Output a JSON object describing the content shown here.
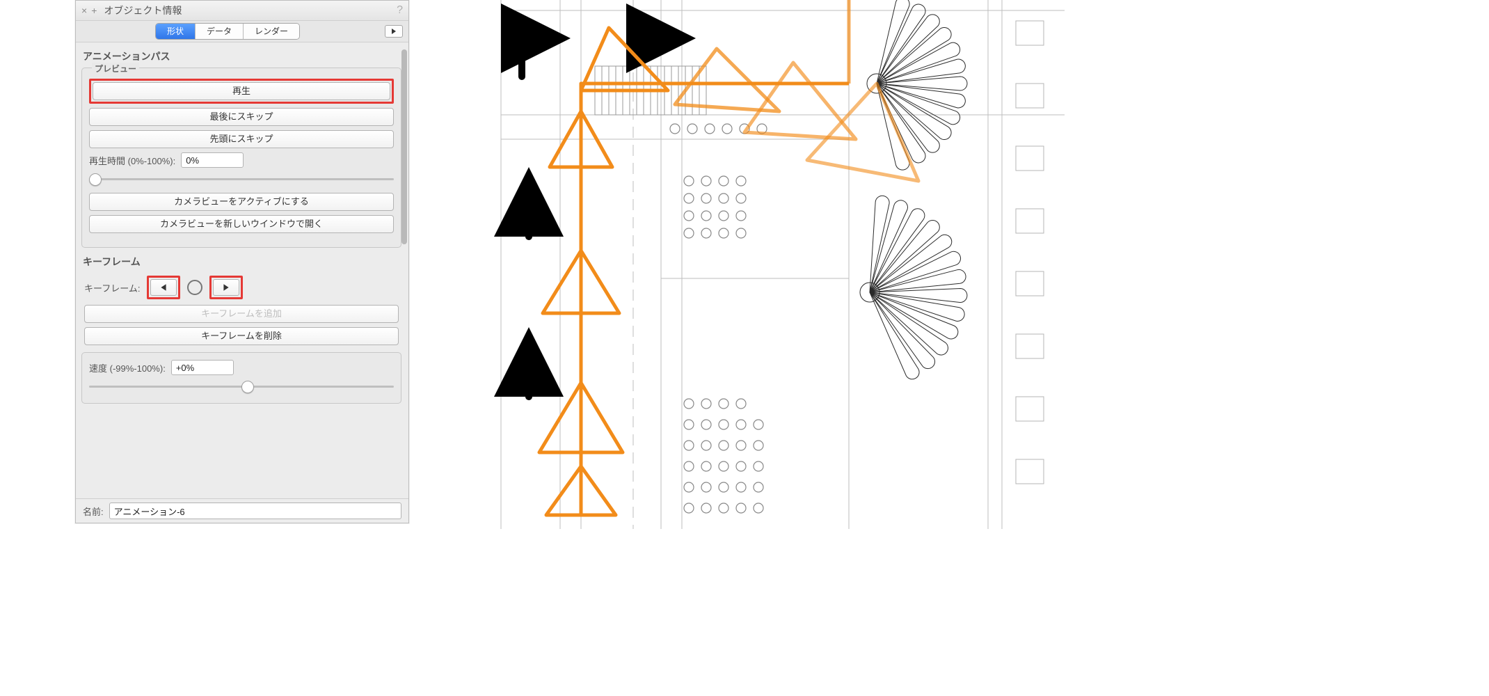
{
  "panel": {
    "title": "オブジェクト情報",
    "tabs": {
      "shape": "形状",
      "data": "データ",
      "render": "レンダー"
    },
    "active_tab": "shape",
    "section_main": "アニメーションパス",
    "preview": {
      "label": "プレビュー",
      "play": "再生",
      "skip_last": "最後にスキップ",
      "skip_first": "先頭にスキップ",
      "time_label": "再生時間 (0%-100%):",
      "time_value": "0%",
      "activate_cam": "カメラビューをアクティブにする",
      "open_cam_win": "カメラビューを新しいウインドウで開く"
    },
    "keyframes": {
      "section": "キーフレーム",
      "label": "キーフレーム:",
      "add": "キーフレームを追加",
      "delete": "キーフレームを削除",
      "speed_label": "速度 (-99%-100%):",
      "speed_value": "+0%"
    },
    "name": {
      "label": "名前:",
      "value": "アニメーション-6"
    }
  }
}
